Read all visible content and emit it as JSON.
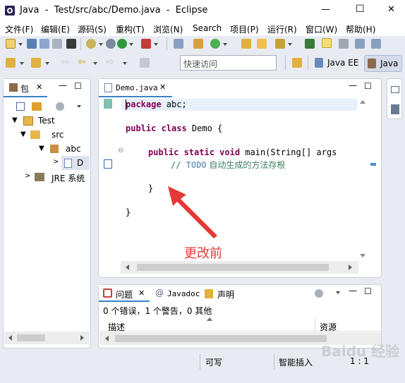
{
  "window": {
    "title": "Java  -  Test/src/abc/Demo.java  -  Eclipse",
    "minimize": "—",
    "maximize": "☐",
    "close": "✕"
  },
  "menu": [
    "文件(F)",
    "编辑(E)",
    "源码(S)",
    "重构(T)",
    "浏览(N)",
    "Search",
    "项目(P)",
    "运行(R)",
    "窗口(W)",
    "帮助(H)"
  ],
  "quick_access": {
    "placeholder": "快速访问"
  },
  "perspectives": [
    "Java EE",
    "Java"
  ],
  "package_explorer": {
    "tab": "包",
    "tree": [
      {
        "label": "Test"
      },
      {
        "label": "src"
      },
      {
        "label": "abc"
      },
      {
        "label": "D"
      },
      {
        "label": "JRE 系统"
      }
    ]
  },
  "editor": {
    "tab": "Demo.java",
    "lines": {
      "l1_kw": "package",
      "l1_rest": " abc;",
      "l2_kw": "public class",
      "l2_rest": " Demo {",
      "l3_kw": "public static void",
      "l3_rest": " main(String[] args",
      "l4_comment": "// ",
      "l4_todo": "TODO",
      "l4_text": " 自动生成的方法存根",
      "l5": "}",
      "l6": "}"
    },
    "annotation": "更改前"
  },
  "bottom": {
    "tabs": [
      "问题",
      "Javadoc",
      "声明"
    ],
    "summary": "0 个错误，1 个警告，0 其他",
    "columns": [
      "描述",
      "资源"
    ]
  },
  "status": {
    "writable": "可写",
    "insert_mode": "智能插入",
    "position": "1 : 1"
  },
  "watermark": "Baidu 经验",
  "colors": {
    "accent": "#3b82c4",
    "arrow": "#e53935",
    "annotation": "#e53935"
  }
}
